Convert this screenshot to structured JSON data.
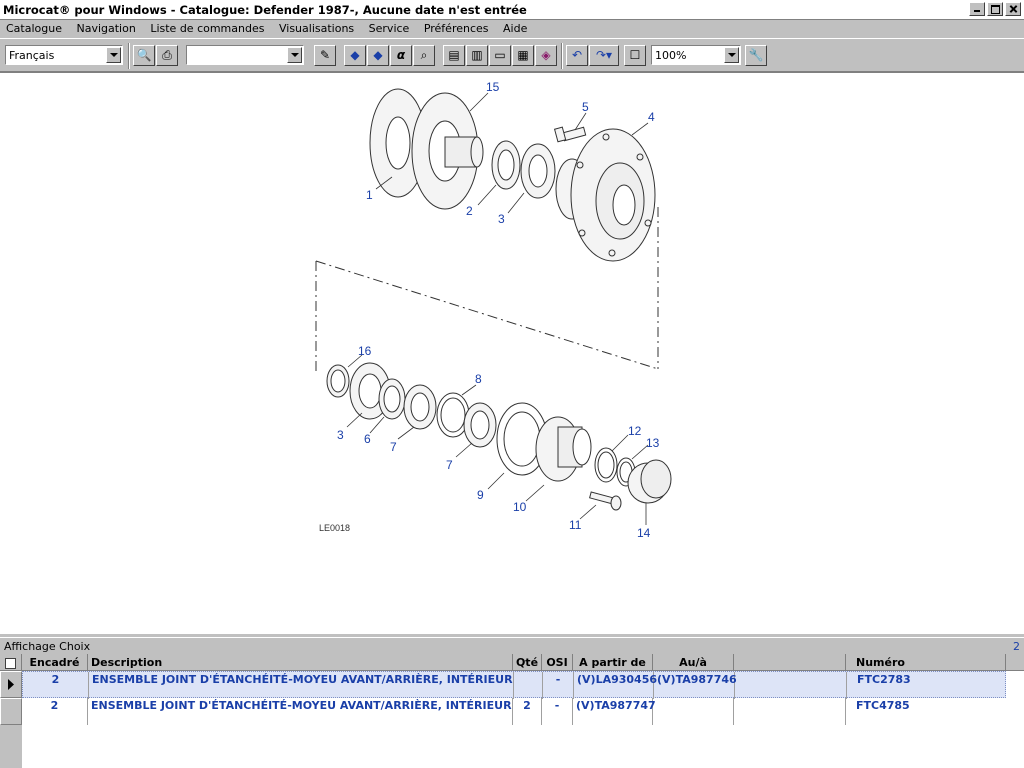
{
  "window": {
    "title": "Microcat® pour Windows - Catalogue: Defender 1987-, Aucune date n'est entrée"
  },
  "menu": [
    "Catalogue",
    "Navigation",
    "Liste de commandes",
    "Visualisations",
    "Service",
    "Préférences",
    "Aide"
  ],
  "toolbar": {
    "language": "Français",
    "search": "",
    "zoom": "100%"
  },
  "diagram": {
    "ref": "LE0018",
    "callouts": [
      "15",
      "5",
      "4",
      "1",
      "2",
      "3",
      "16",
      "8",
      "3",
      "6",
      "7",
      "7",
      "12",
      "13",
      "9",
      "10",
      "11",
      "14"
    ]
  },
  "panel": {
    "title": "Affichage Choix",
    "count": "2"
  },
  "table": {
    "headers": [
      "Encadré",
      "Description",
      "Qté",
      "OSI",
      "A partir de",
      "Au/à",
      "",
      "Numéro"
    ],
    "rows": [
      {
        "encadre": "2",
        "description": "ENSEMBLE JOINT D'ÉTANCHÉITÉ-MOYEU AVANT/ARRIÈRE, INTÉRIEUR",
        "qte": "",
        "osi": "-",
        "from": "(V)LA930456",
        "to": "(V)TA987746",
        "numero": "FTC2783"
      },
      {
        "encadre": "2",
        "description": "ENSEMBLE JOINT D'ÉTANCHÉITÉ-MOYEU AVANT/ARRIÈRE, INTÉRIEUR",
        "qte": "2",
        "osi": "-",
        "from": "(V)TA987747",
        "to": "",
        "numero": "FTC4785"
      }
    ]
  },
  "colors": {
    "accent": "#1a3fa8",
    "selected_row": "#dde4f7"
  }
}
